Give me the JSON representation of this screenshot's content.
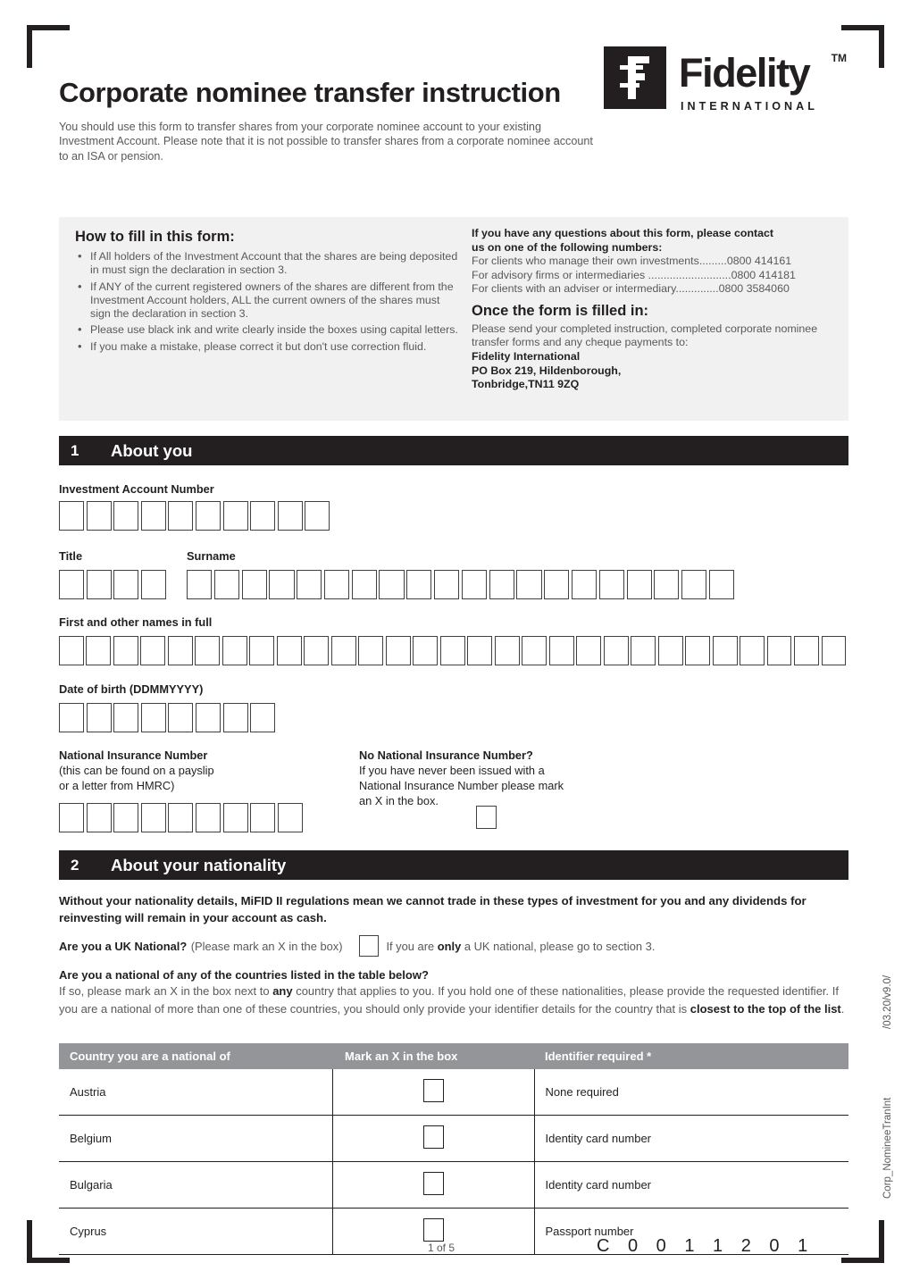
{
  "document": {
    "title": "Corporate nominee transfer instruction",
    "intro": "You should use this form to transfer shares from your corporate nominee account to your existing Investment Account. Please note that it is not possible to transfer shares from a corporate nominee account to an ISA or pension.",
    "page_number": "1 of 5",
    "barcode": "C 0 0 1 1 2 0 1",
    "side_code_top": "/03.20/v9.0/",
    "side_code_bottom": "Corp_NomineeTranInt"
  },
  "logo": {
    "mark": "fidelity-f-mark",
    "wordmark": "Fidelity",
    "trademark": "TM",
    "subtitle": "INTERNATIONAL"
  },
  "info_panel": {
    "how_to": {
      "heading": "How to fill in this form:",
      "bullets": [
        "If All holders of the Investment Account that the shares are being deposited in must sign the declaration in section 3.",
        "If ANY of the current registered owners of the shares are different from the Investment Account holders, ALL the current owners of the shares must sign the declaration in section 3.",
        "Please use black ink and write clearly inside the boxes using capital letters.",
        "If you make a mistake, please correct it but don't use correction fluid."
      ]
    },
    "contact": {
      "heading_line1": "If you have any questions about this form, please contact",
      "heading_line2": "us on one of the following numbers:",
      "numbers": [
        {
          "label": "For clients who manage their own investments",
          "dots": ".........",
          "number": "0800 414161"
        },
        {
          "label": "For advisory firms or intermediaries",
          "dots": " ...........................",
          "number": "0800 414181"
        },
        {
          "label": "For clients with an adviser or intermediary",
          "dots": "..............",
          "number": "0800 3584060"
        }
      ],
      "once_filled_heading": "Once the form is filled in:",
      "once_filled_text": "Please send your completed instruction, completed corporate nominee transfer forms and any cheque payments to:",
      "address": [
        "Fidelity International",
        "PO Box 219, Hildenborough,",
        "Tonbridge,TN11 9ZQ"
      ]
    }
  },
  "section1": {
    "number": "1",
    "title": "About you",
    "fields": {
      "account_number_label": "Investment Account Number",
      "account_number_boxes": 10,
      "title_label": "Title",
      "title_boxes": 4,
      "surname_label": "Surname",
      "surname_boxes": 20,
      "first_names_label": "First and other names in full",
      "first_names_boxes": 29,
      "dob_label": "Date of birth (DDMMYYYY)",
      "dob_boxes": 8,
      "ni_label": "National Insurance Number",
      "ni_sub_line1": "(this can be found on a payslip",
      "ni_sub_line2": "or a letter from HMRC)",
      "ni_boxes": 9,
      "no_ni_label": "No National Insurance Number?",
      "no_ni_line1": "If you have never been issued with a",
      "no_ni_line2": "National Insurance Number please mark",
      "no_ni_line3": "an X in the box."
    }
  },
  "section2": {
    "number": "2",
    "title": "About your nationality",
    "mifid_note": "Without your nationality details, MiFID II regulations mean we cannot trade in these types of investment for you and any dividends for reinvesting will remain in your account as cash.",
    "uk_question_bold": "Are you a UK National?",
    "uk_question_rest": "(Please mark an X in the box)",
    "uk_after_box_pre": "If you are ",
    "uk_after_box_bold": "only",
    "uk_after_box_post": " a UK national, please go to section 3.",
    "country_question": "Are you a national of any of the countries listed in the table below?",
    "country_paragraph_1": "If so, please mark an X in the box next to ",
    "country_paragraph_bold_1": "any",
    "country_paragraph_2": " country that applies to you. If you hold one of these nationalities, please provide the requested identifier. If you are a national of more than one of these countries, you should only provide your identifier details for the country that is ",
    "country_paragraph_bold_2": "closest to the top of the list",
    "country_paragraph_3": ".",
    "table": {
      "headers": [
        "Country you are a national of",
        "Mark an X in the box",
        "Identifier required *"
      ],
      "rows": [
        {
          "country": "Austria",
          "identifier": "None required"
        },
        {
          "country": "Belgium",
          "identifier": "Identity card number"
        },
        {
          "country": "Bulgaria",
          "identifier": "Identity card number"
        },
        {
          "country": "Cyprus",
          "identifier": "Passport number"
        }
      ]
    }
  },
  "colors": {
    "ink": "#231f20",
    "grey_text": "#58595b",
    "panel_bg": "#f1f1f2",
    "table_header_bg": "#939598"
  }
}
